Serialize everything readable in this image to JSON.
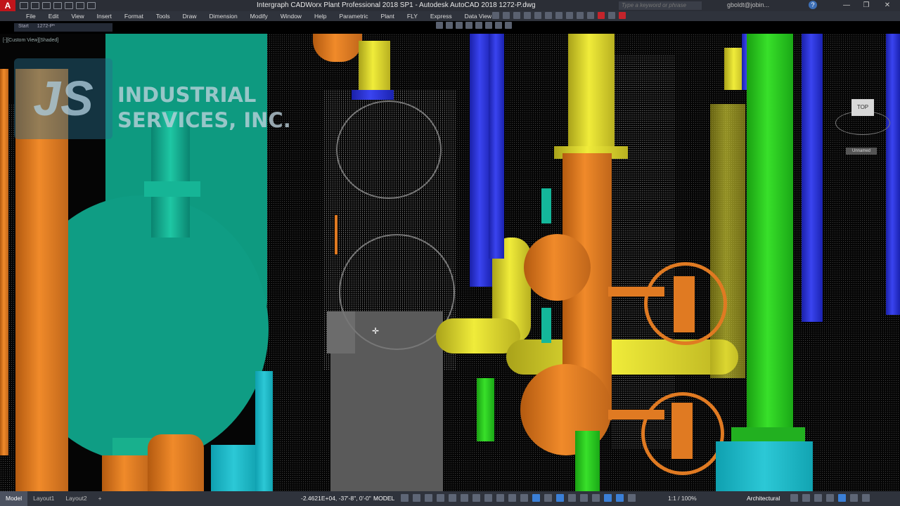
{
  "window": {
    "title": "Intergraph CADWorx Plant Professional 2018 SP1 - Autodesk AutoCAD 2018   1272-P.dwg",
    "app_icon": "A",
    "search_placeholder": "Type a keyword or phrase",
    "user": "gboldt@jobin...",
    "help_icon": "?",
    "minimize": "—",
    "maximize": "❐",
    "close": "✕"
  },
  "menu": {
    "items": [
      "File",
      "Edit",
      "View",
      "Insert",
      "Format",
      "Tools",
      "Draw",
      "Dimension",
      "Modify",
      "Window",
      "Help",
      "Parametric",
      "Plant",
      "FLY",
      "Express",
      "Data View"
    ]
  },
  "file_tabs": {
    "start": "Start",
    "drawing": "1272-P*"
  },
  "viewport": {
    "label": "[-][Custom View][Shaded]",
    "viewcube_face": "TOP",
    "wcs": "Unnamed"
  },
  "logo": {
    "mark": "JS",
    "line1": "INDUSTRIAL",
    "line2": "SERVICES, INC."
  },
  "status": {
    "tabs": [
      "Model",
      "Layout1",
      "Layout2"
    ],
    "add_tab": "+",
    "coords": "-2.4621E+04, -37'-8\", 0'-0\"",
    "model": "MODEL",
    "scale": "1:1 / 100%",
    "units": "Architectural"
  },
  "colors": {
    "orange": "#f08a2a",
    "yellow": "#f0ec3a",
    "blue": "#3a44f0",
    "green": "#38e02a",
    "teal": "#0e9a80",
    "cyan": "#2cc8d6"
  }
}
